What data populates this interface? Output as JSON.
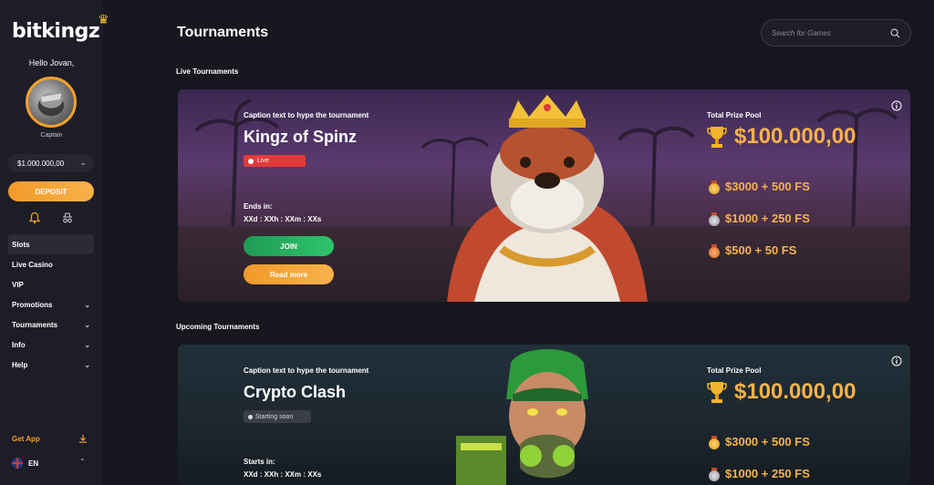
{
  "brand": {
    "name": "bitkingz"
  },
  "sidebar": {
    "greeting": "Hello Jovan,",
    "rank": "Captain",
    "balance": "$1.000.000,00",
    "deposit_label": "DEPOSIT",
    "nav": [
      {
        "label": "Slots",
        "active": true,
        "has_chevron": false
      },
      {
        "label": "Live Casino",
        "has_chevron": false
      },
      {
        "label": "VIP",
        "has_chevron": false
      },
      {
        "label": "Promotions",
        "has_chevron": true
      },
      {
        "label": "Tournaments",
        "has_chevron": true
      },
      {
        "label": "Info",
        "has_chevron": true
      },
      {
        "label": "Help",
        "has_chevron": true
      }
    ],
    "get_app": "Get App",
    "language": "EN"
  },
  "header": {
    "title": "Tournaments",
    "search_placeholder": "Search for Games"
  },
  "sections": {
    "live_title": "Live Tournaments",
    "upcoming_title": "Upcoming Tournaments"
  },
  "live_tournament": {
    "caption": "Caption text to hype the tournament",
    "name": "Kingz of Spinz",
    "status": "Live",
    "timer_label": "Ends in:",
    "timer": "XXd : XXh : XXm : XXs",
    "join_label": "JOIN",
    "read_more_label": "Read more",
    "prize_label": "Total Prize Pool",
    "prize_total": "$100.000,00",
    "prizes": [
      "$3000 + 500 FS",
      "$1000 + 250 FS",
      "$500 + 50 FS"
    ]
  },
  "upcoming_tournament": {
    "caption": "Caption text to hype the tournament",
    "name": "Crypto Clash",
    "status": "Starting soon",
    "timer_label": "Starts in:",
    "timer": "XXd : XXh : XXm : XXs",
    "prize_label": "Total Prize Pool",
    "prize_total": "$100.000,00",
    "prizes": [
      "$3000 + 500 FS",
      "$1000 + 250 FS"
    ]
  },
  "colors": {
    "accent": "#f4a02a",
    "live": "#e23a3a",
    "join": "#2ec46a",
    "background": "#16171f",
    "sidebar": "#1c1d27"
  }
}
